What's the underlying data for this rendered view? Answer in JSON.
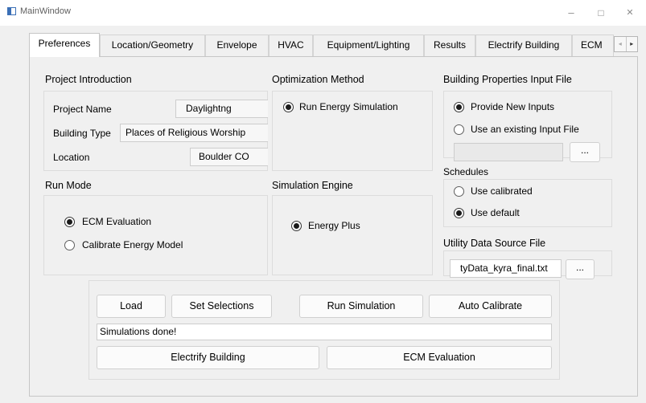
{
  "window": {
    "title": "MainWindow",
    "minimize": "–",
    "maximize": "□",
    "close": "✕"
  },
  "tabs": [
    {
      "label": "Preferences",
      "active": true
    },
    {
      "label": "Location/Geometry"
    },
    {
      "label": "Envelope"
    },
    {
      "label": "HVAC"
    },
    {
      "label": "Equipment/Lighting"
    },
    {
      "label": "Results"
    },
    {
      "label": "Electrify Building"
    },
    {
      "label": "ECM"
    }
  ],
  "tab_scroll": {
    "left": "◂",
    "right": "▸"
  },
  "project_intro": {
    "title": "Project Introduction",
    "project_name_label": "Project Name",
    "project_name_value": "Daylightng",
    "building_type_label": "Building Type",
    "building_type_value": "Places of Religious Worship",
    "location_label": "Location",
    "location_value": "Boulder CO"
  },
  "optimization": {
    "title": "Optimization Method",
    "option": "Run Energy Simulation"
  },
  "building_props": {
    "title": "Building Properties Input File",
    "option_new": "Provide New Inputs",
    "option_existing": "Use an existing Input File",
    "browse": "..."
  },
  "schedules": {
    "title": "Schedules",
    "option_calibrated": "Use calibrated",
    "option_default": "Use default"
  },
  "run_mode": {
    "title": "Run Mode",
    "option_ecm": "ECM Evaluation",
    "option_calibrate": "Calibrate Energy Model"
  },
  "sim_engine": {
    "title": "Simulation Engine",
    "option": "Energy Plus"
  },
  "utility": {
    "title": "Utility Data Source File",
    "file": "tyData_kyra_final.txt",
    "browse": "..."
  },
  "actions": {
    "load": "Load",
    "set_selections": "Set Selections",
    "run_simulation": "Run Simulation",
    "auto_calibrate": "Auto Calibrate",
    "status": "Simulations done!",
    "electrify": "Electrify Building",
    "ecm_evaluation": "ECM Evaluation"
  }
}
